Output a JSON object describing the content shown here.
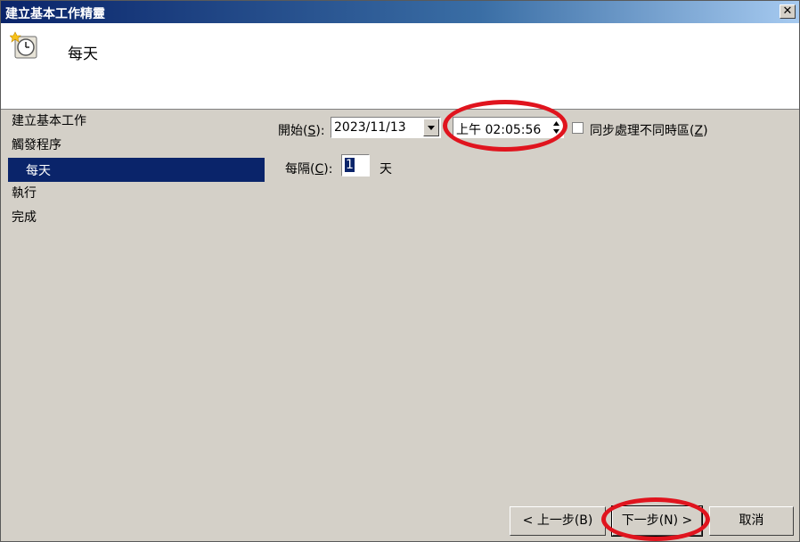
{
  "window": {
    "title": "建立基本工作精靈"
  },
  "header": {
    "title": "每天",
    "icon": "scheduled-clock-icon"
  },
  "sidebar": {
    "items": [
      {
        "label": "建立基本工作"
      },
      {
        "label": "觸發程序"
      },
      {
        "label": "每天"
      },
      {
        "label": "執行"
      },
      {
        "label": "完成"
      }
    ],
    "selected": "每天"
  },
  "form": {
    "start_label": "開始(",
    "start_key": "S",
    "start_close": "):",
    "start_date": "2023/11/13",
    "start_time": "上午 02:05:56",
    "sync_label": "同步處理不同時區(",
    "sync_key": "Z",
    "sync_close": ")",
    "sync_checked": false,
    "recur_label": "每隔(",
    "recur_key": "C",
    "recur_close": "):",
    "recur_value": "1",
    "recur_unit": "天"
  },
  "buttons": {
    "back": "< 上一步(B)",
    "next": "下一步(N) >",
    "cancel": "取消"
  },
  "colors": {
    "selection": "#0a246a",
    "annotation": "#e0141e",
    "dialog_bg": "#d4d0c8"
  }
}
